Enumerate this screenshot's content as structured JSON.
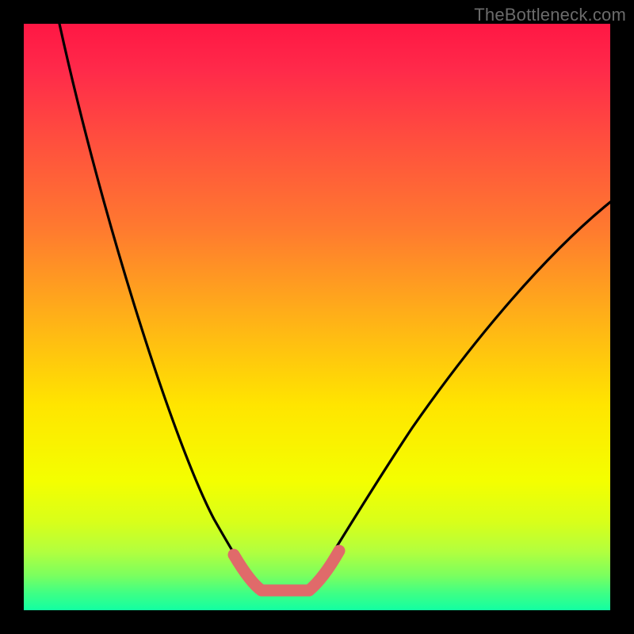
{
  "watermark": "TheBottleneck.com",
  "colors": {
    "gradient_top": "#ff1744",
    "gradient_mid": "#ffe500",
    "gradient_bottom": "#12ffa2",
    "curve": "#000000",
    "valley_highlight": "#e06a6a",
    "frame": "#000000"
  },
  "chart_data": {
    "type": "line",
    "title": "",
    "xlabel": "",
    "ylabel": "",
    "xlim": [
      0,
      100
    ],
    "ylim": [
      0,
      100
    ],
    "grid": false,
    "notes": "Bottleneck-style V-curve on vertical red→yellow→green gradient. Lower y (toward green) = better. The thick coral band at the valley floor marks the optimal/no-bottleneck region. Axes are unlabeled; x/y are normalized 0–100 estimates from pixel position.",
    "series": [
      {
        "name": "left-branch",
        "x": [
          6,
          10,
          15,
          20,
          25,
          30,
          35,
          38.5
        ],
        "y": [
          100,
          82,
          64,
          48,
          33,
          20,
          10,
          5.4
        ],
        "style": "thin-black"
      },
      {
        "name": "right-branch",
        "x": [
          50,
          55,
          60,
          66,
          75,
          85,
          95,
          100
        ],
        "y": [
          5.4,
          10,
          17,
          25,
          38,
          53,
          65,
          70
        ],
        "style": "thin-black"
      },
      {
        "name": "optimal-band",
        "x": [
          35.8,
          38,
          40.5,
          44,
          48.7,
          51,
          53.8
        ],
        "y": [
          9.5,
          6,
          3.8,
          3.4,
          3.8,
          6,
          10.1
        ],
        "style": "thick-coral"
      }
    ],
    "background_gradient": {
      "direction": "vertical",
      "stops": [
        {
          "pos": 0.0,
          "color": "#ff1744"
        },
        {
          "pos": 0.5,
          "color": "#ffb018"
        },
        {
          "pos": 0.78,
          "color": "#f4ff00"
        },
        {
          "pos": 1.0,
          "color": "#12ffa2"
        }
      ]
    }
  }
}
